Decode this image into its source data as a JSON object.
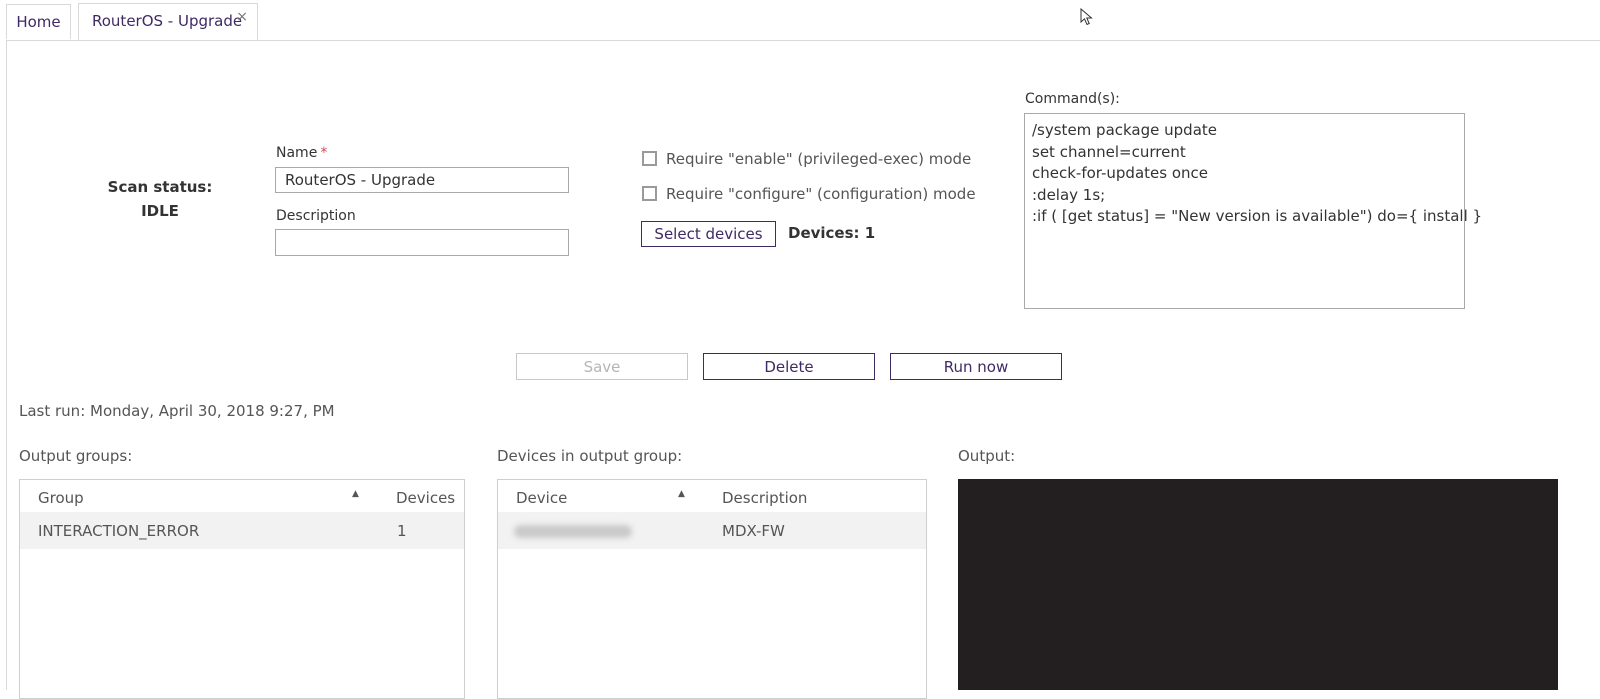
{
  "tabs": [
    {
      "label": "Home"
    },
    {
      "label": "RouterOS - Upgrade",
      "close": "×"
    }
  ],
  "scan": {
    "label": "Scan status:",
    "value": "IDLE"
  },
  "form": {
    "name_label": "Name",
    "required_mark": "*",
    "name_value": "RouterOS - Upgrade",
    "description_label": "Description",
    "description_value": ""
  },
  "options": {
    "enable_mode": "Require \"enable\" (privileged-exec) mode",
    "configure_mode": "Require \"configure\" (configuration) mode",
    "select_devices": "Select devices",
    "devices_count": "Devices: 1"
  },
  "commands": {
    "label": "Command(s):",
    "lines": [
      "/system package update",
      "set channel=current",
      "check-for-updates once",
      ":delay 1s;",
      ":if ( [get status] = \"New version is available\") do={ install }"
    ]
  },
  "actions": {
    "save": "Save",
    "delete": "Delete",
    "run_now": "Run now"
  },
  "last_run": "Last run: Monday, April 30, 2018 9:27, PM",
  "output_groups": {
    "label": "Output groups:",
    "columns": [
      "Group",
      "Devices"
    ],
    "rows": [
      {
        "group": "INTERACTION_ERROR",
        "devices": "1"
      }
    ]
  },
  "devices_in_group": {
    "label": "Devices in output group:",
    "columns": [
      "Device",
      "Description"
    ],
    "rows": [
      {
        "device": "",
        "description": "MDX-FW"
      }
    ]
  },
  "output": {
    "label": "Output:",
    "background": "#231f20"
  },
  "colors": {
    "accent": "#3f2a63",
    "required": "#d6454f"
  }
}
